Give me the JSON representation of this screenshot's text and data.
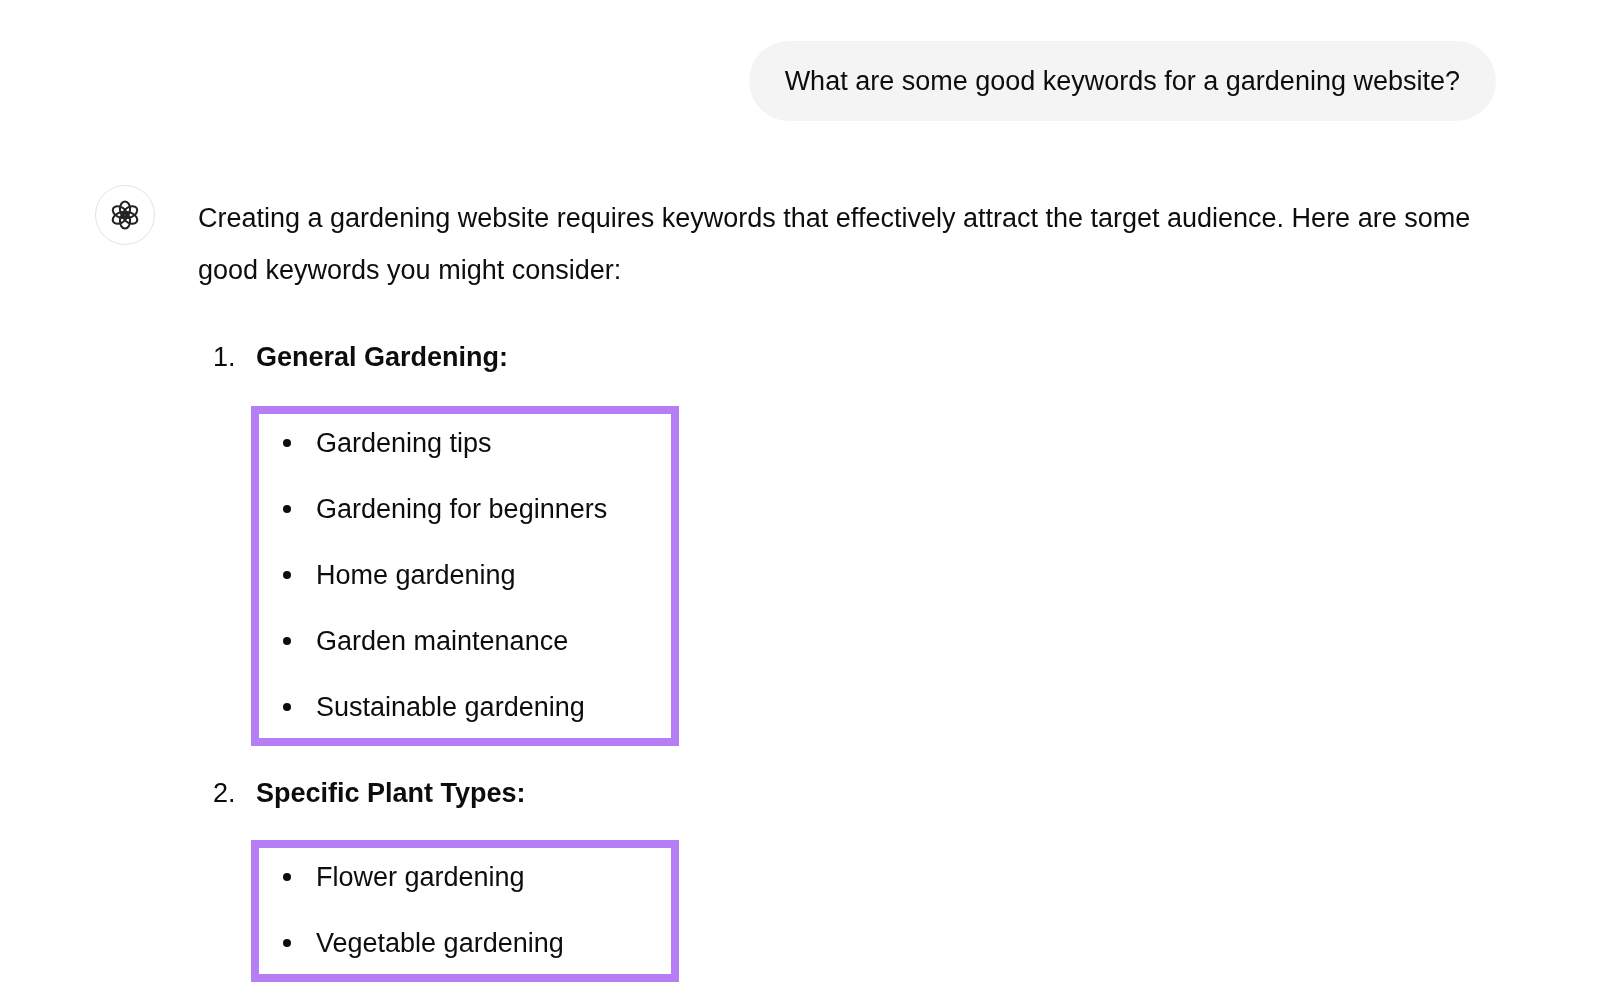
{
  "user_message": "What are some good keywords for a gardening website?",
  "assistant": {
    "intro": "Creating a gardening website requires keywords that effectively attract the target audience. Here are some good keywords you might consider:",
    "sections": [
      {
        "number": "1.",
        "title": "General Gardening:",
        "highlighted": true,
        "items": [
          "Gardening tips",
          "Gardening for beginners",
          "Home gardening",
          "Garden maintenance",
          "Sustainable gardening"
        ]
      },
      {
        "number": "2.",
        "title": "Specific Plant Types:",
        "highlighted": true,
        "items": [
          "Flower gardening",
          "Vegetable gardening"
        ]
      }
    ]
  }
}
